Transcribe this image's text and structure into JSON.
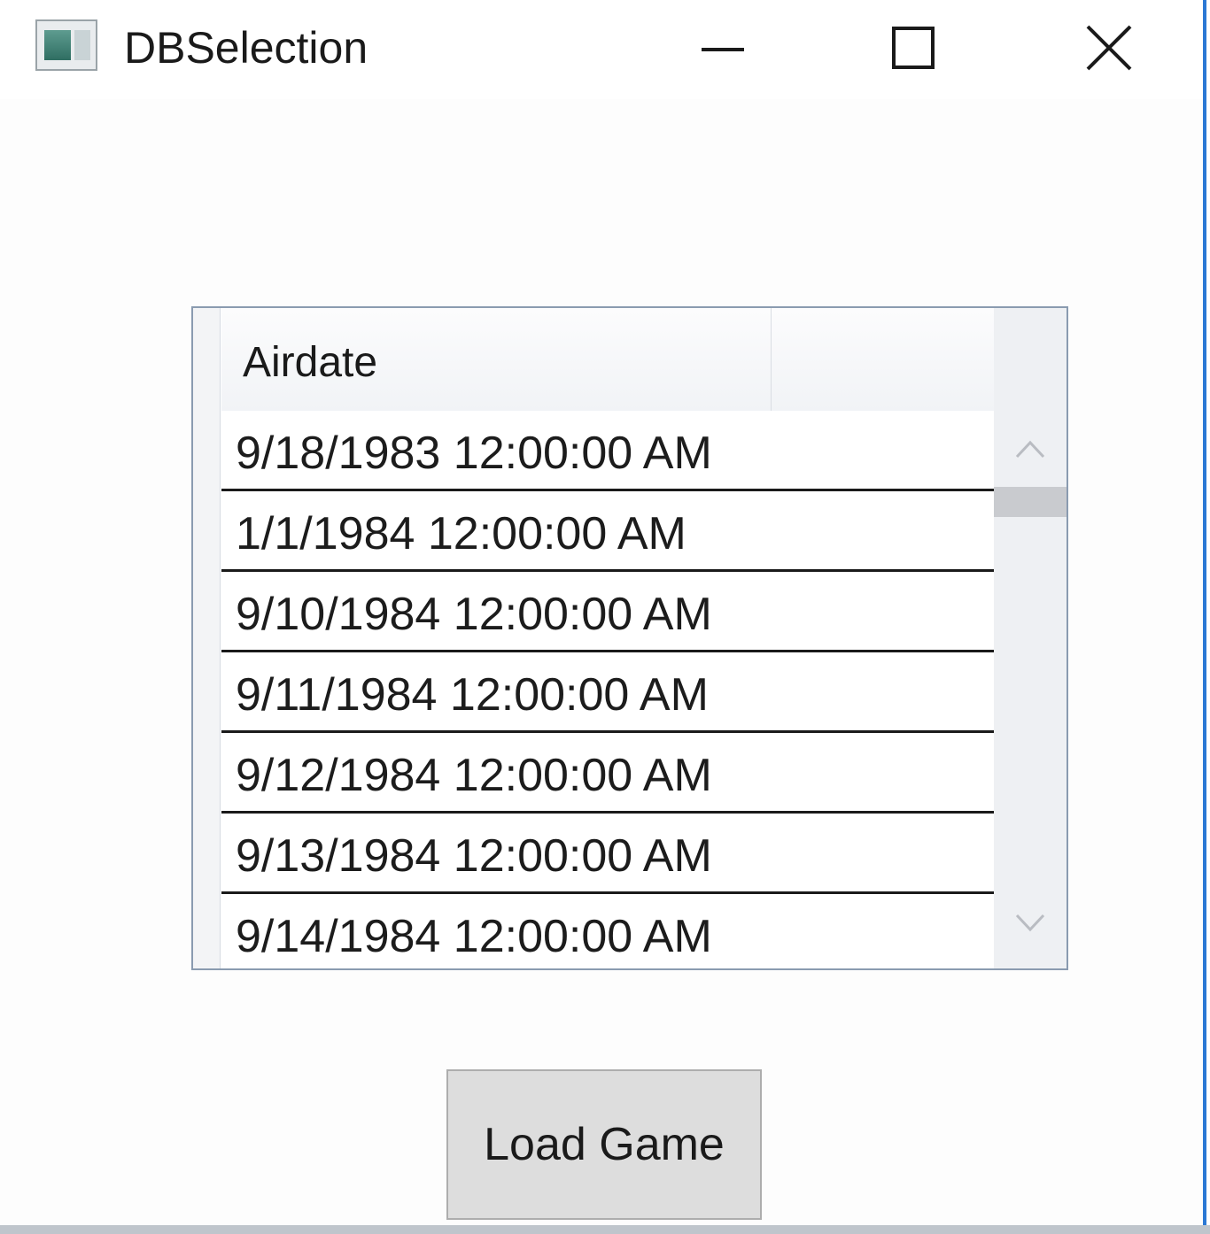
{
  "window": {
    "title": "DBSelection",
    "icons": {
      "app": "app-window-icon",
      "minimize": "minimize-icon",
      "maximize": "maximize-icon",
      "close": "close-icon"
    }
  },
  "grid": {
    "columns": [
      {
        "header": "Airdate"
      }
    ],
    "rows": [
      {
        "airdate": "9/18/1983 12:00:00 AM"
      },
      {
        "airdate": "1/1/1984 12:00:00 AM"
      },
      {
        "airdate": "9/10/1984 12:00:00 AM"
      },
      {
        "airdate": "9/11/1984 12:00:00 AM"
      },
      {
        "airdate": "9/12/1984 12:00:00 AM"
      },
      {
        "airdate": "9/13/1984 12:00:00 AM"
      },
      {
        "airdate": "9/14/1984 12:00:00 AM"
      }
    ],
    "scrollbar": {
      "up_icon": "chevron-up-icon",
      "down_icon": "chevron-down-icon"
    }
  },
  "actions": {
    "load_label": "Load Game"
  },
  "colors": {
    "window_border": "#2b78d4",
    "grid_border": "#8a9bb0",
    "button_face": "#dddddd"
  }
}
